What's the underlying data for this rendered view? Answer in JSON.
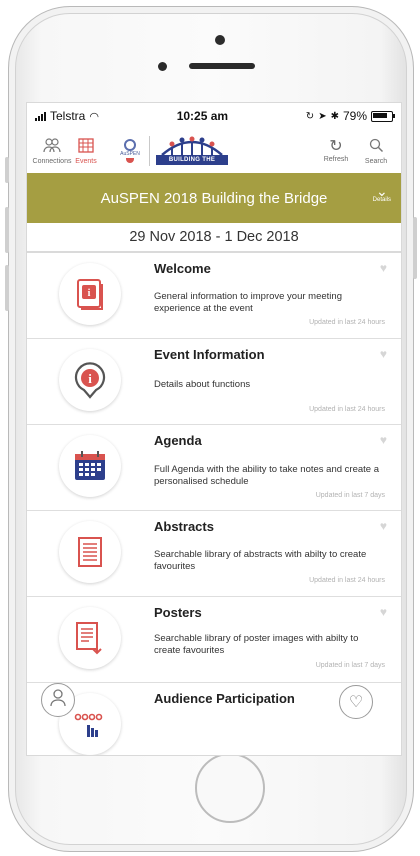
{
  "status": {
    "carrier": "Telstra",
    "time": "10:25 am",
    "battery": "79%"
  },
  "toolbar": {
    "connections": "Connections",
    "events": "Events",
    "refresh": "Refresh",
    "search": "Search",
    "ausp_logo_text": "AuSPEN",
    "btb_logo_text": "BUILDING THE BRIDGE"
  },
  "banner": {
    "title": "AuSPEN 2018 Building the Bridge",
    "details": "Details",
    "dates": "29 Nov 2018 - 1 Dec 2018"
  },
  "items": [
    {
      "title": "Welcome",
      "desc": "General information to improve your meeting experience at the event",
      "updated": "Updated in last 24 hours",
      "icon": "book-icon"
    },
    {
      "title": "Event Information",
      "desc": "Details about functions",
      "updated": "Updated in last 24 hours",
      "icon": "info-pin-icon"
    },
    {
      "title": "Agenda",
      "desc": "Full Agenda with the ability to take notes and create a personalised schedule",
      "updated": "Updated in last 7 days",
      "icon": "calendar-icon"
    },
    {
      "title": "Abstracts",
      "desc": "Searchable library of abstracts with abilty to create favourites",
      "updated": "Updated in last 24 hours",
      "icon": "document-icon"
    },
    {
      "title": "Posters",
      "desc": "Searchable library of poster images with abilty to create favourites",
      "updated": "Updated in last 7 days",
      "icon": "poster-icon"
    },
    {
      "title": "Audience Participation",
      "desc": "",
      "updated": "",
      "icon": "audience-icon"
    }
  ],
  "colors": {
    "banner": "#a59e42",
    "accent_red": "#d9534f",
    "navy": "#2d3f8c"
  }
}
